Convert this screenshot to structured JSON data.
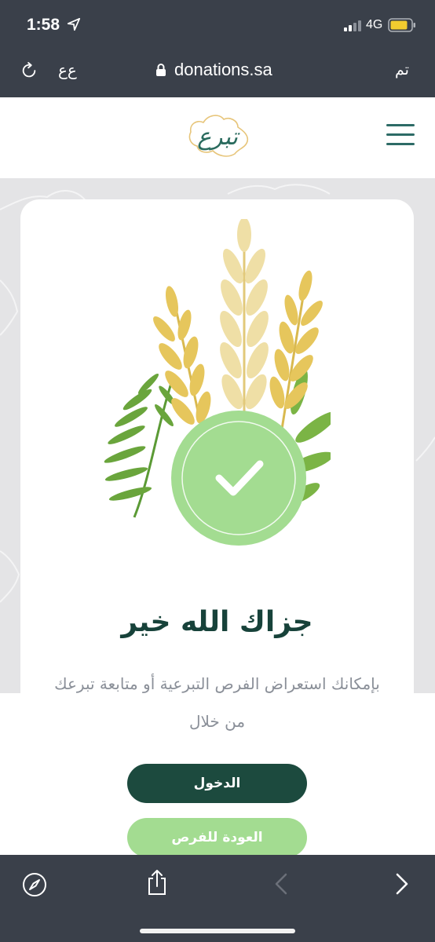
{
  "status_bar": {
    "time": "1:58",
    "network": "4G"
  },
  "browser": {
    "text_size_label": "ﻉﻉ",
    "url": "donations.sa",
    "done_label": "تم"
  },
  "card": {
    "title": "جزاك الله خير",
    "subtitle": "بإمكانك استعراض الفرص التبرعية أو متابعة تبرعك من خلال",
    "login_label": "الدخول",
    "back_label": "العودة للفرص"
  },
  "colors": {
    "brand_dark": "#1c4a3e",
    "brand_light_green": "#a3dc91",
    "chrome": "#3a404a"
  },
  "icons": {
    "status": [
      "location-arrow-icon",
      "signal-icon",
      "battery-icon"
    ],
    "browser": [
      "reload-icon",
      "lock-icon"
    ],
    "toolbar": [
      "compass-icon",
      "share-icon",
      "back-arrow-icon",
      "forward-arrow-icon"
    ]
  }
}
